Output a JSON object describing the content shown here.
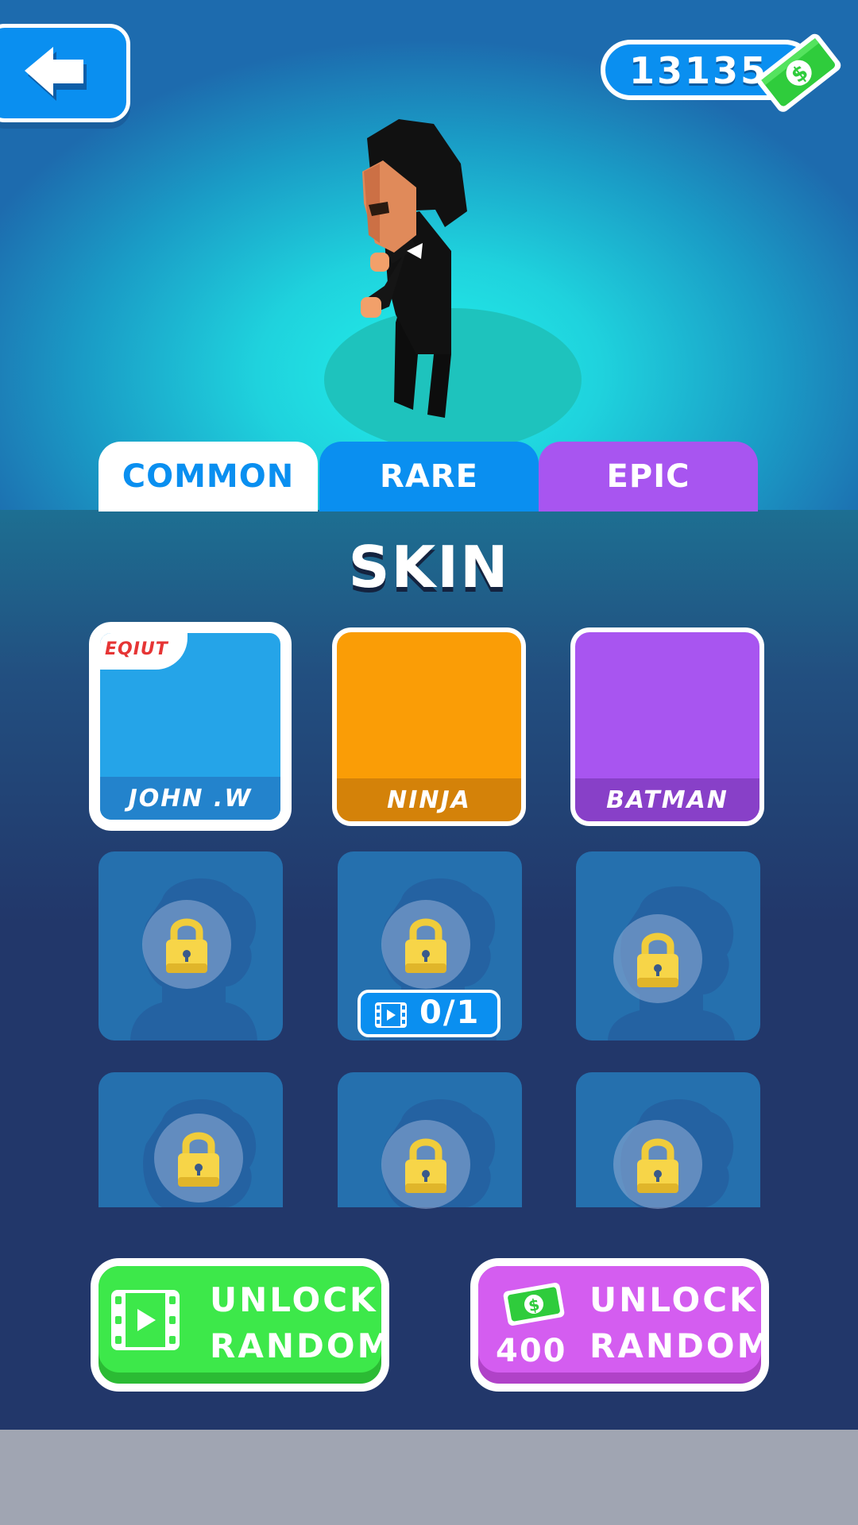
{
  "currency": {
    "amount": "13135",
    "icon": "cash-icon"
  },
  "tabs": [
    {
      "label": "COMMON",
      "color": "#0a8ff0",
      "active": true
    },
    {
      "label": "RARE",
      "color": "#0a8ff0",
      "active": false
    },
    {
      "label": "EPIC",
      "color": "#a855f0",
      "active": false
    }
  ],
  "section_title": "SKIN",
  "skins": [
    {
      "name": "JOHN .W",
      "badge": "EQIUT",
      "color": "#25a4e8",
      "status": "equipped"
    },
    {
      "name": "NINJA",
      "color": "#fa9d06",
      "status": "owned"
    },
    {
      "name": "BATMAN",
      "color": "#a855f0",
      "status": "owned"
    }
  ],
  "locked_slot_count": 6,
  "video_progress": "0/1",
  "buttons": {
    "unlock_video": {
      "line1": "UNLOCK",
      "line2": "RANDOM",
      "icon": "film-icon",
      "color": "#3de84a"
    },
    "unlock_cash": {
      "line1": "UNLOCK",
      "line2": "RANDOM",
      "price": "400",
      "icon": "cash-icon",
      "color": "#d45df0"
    }
  }
}
